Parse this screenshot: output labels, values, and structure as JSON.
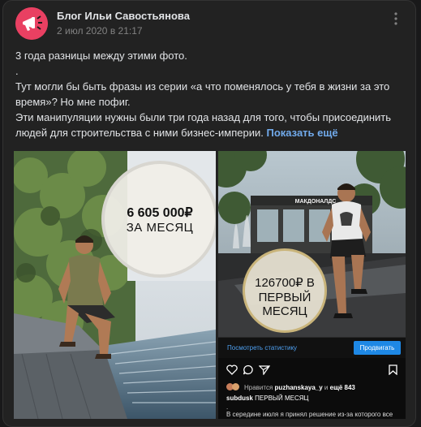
{
  "post": {
    "author": "Блог Ильи Савостьянова",
    "date": "2 июл 2020 в 21:17",
    "text_lines": [
      "3 года разницы между этими фото.",
      ".",
      "Тут могли бы быть фразы из серии «а что поменялось у тебя в жизни за это время»? Но мне пофиг.",
      "Эти манипуляции нужны были три года назад для того, чтобы присоединить людей для строительства с ними бизнес-империи. "
    ],
    "show_more": "Показать ещё"
  },
  "photo_left": {
    "amount": "6 605 000₽",
    "period": "ЗА МЕСЯЦ"
  },
  "photo_right": {
    "sign": "МАКДОНАЛДС",
    "amount": "126700₽ В",
    "period": "ПЕРВЫЙ",
    "period2": "МЕСЯЦ",
    "stats_link": "Посмотреть статистику",
    "promote_button": "Продвигать",
    "likes_prefix": "Нравится",
    "likes_user": "puzhanskaya_y",
    "likes_and": "и",
    "likes_more": "ещё 843",
    "caption_user": "subdusk",
    "caption_text": "ПЕРВЫЙ МЕСЯЦ",
    "dot": ".",
    "caption_more": "В середине июля я принял решение из-за которого все"
  },
  "colors": {
    "background": "#19191a",
    "card": "#222222",
    "link": "#71aaeb",
    "avatar": "#e94062",
    "insta_blue": "#1e88e5"
  },
  "icons": [
    "more-vertical-icon",
    "heart-icon",
    "comment-icon",
    "share-icon",
    "bookmark-icon"
  ]
}
